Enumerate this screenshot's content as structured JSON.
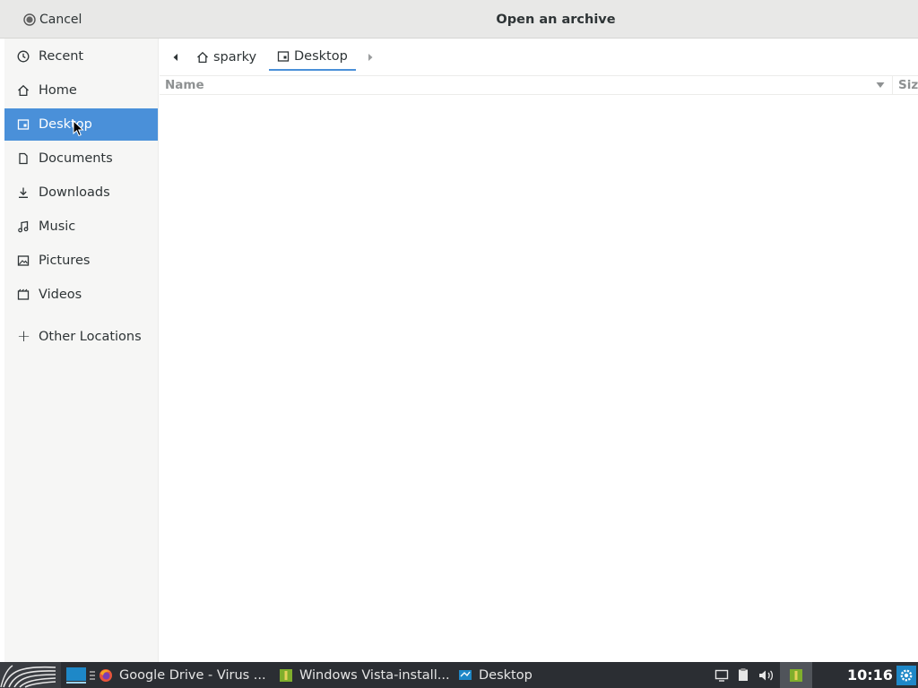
{
  "dialog": {
    "title": "Open an archive",
    "cancel_label": "Cancel"
  },
  "sidebar": {
    "items": [
      {
        "label": "Recent",
        "icon": "clock-icon"
      },
      {
        "label": "Home",
        "icon": "home-icon"
      },
      {
        "label": "Desktop",
        "icon": "desktop-icon",
        "selected": true
      },
      {
        "label": "Documents",
        "icon": "document-icon"
      },
      {
        "label": "Downloads",
        "icon": "download-icon"
      },
      {
        "label": "Music",
        "icon": "music-icon"
      },
      {
        "label": "Pictures",
        "icon": "picture-icon"
      },
      {
        "label": "Videos",
        "icon": "video-icon"
      }
    ],
    "other_locations": "Other Locations"
  },
  "pathbar": {
    "segments": [
      {
        "label": "sparky",
        "icon": "home-icon"
      },
      {
        "label": "Desktop",
        "icon": "desktop-icon",
        "active": true
      }
    ]
  },
  "columns": {
    "name": "Name",
    "size": "Size"
  },
  "taskbar": {
    "tasks": [
      {
        "label": "Google Drive - Virus ...",
        "icon": "firefox-icon"
      },
      {
        "label": "Windows Vista-install...",
        "icon": "archive-manager-icon"
      },
      {
        "label": "Desktop",
        "icon": "desktop-window-icon"
      }
    ],
    "clock": "10:16"
  },
  "colors": {
    "accent": "#4a90d9",
    "taskbar": "#2b2e33",
    "sidebar": "#f6f6f5",
    "header": "#e8e8e7"
  }
}
